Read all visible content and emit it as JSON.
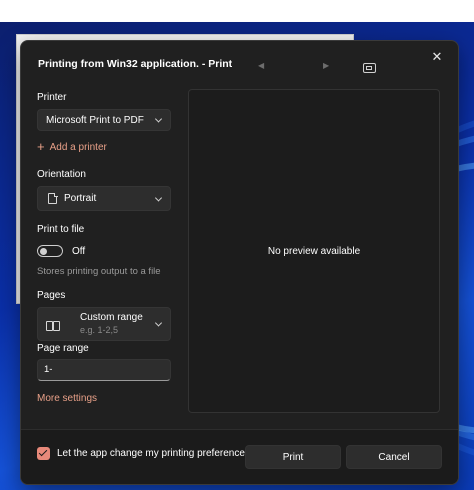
{
  "dialog": {
    "title": "Printing from Win32 application. - Print",
    "close_icon": "close-icon"
  },
  "printer": {
    "label": "Printer",
    "selected": "Microsoft Print to PDF",
    "add_label": "Add a printer"
  },
  "orientation": {
    "label": "Orientation",
    "selected": "Portrait"
  },
  "print_to_file": {
    "label": "Print to file",
    "state": "Off",
    "hint": "Stores printing output to a file"
  },
  "pages": {
    "label": "Pages",
    "selected": "Custom range",
    "example": "e.g. 1-2,5"
  },
  "page_range": {
    "label": "Page range",
    "value": "1-"
  },
  "more_settings": "More settings",
  "preview": {
    "message": "No preview available"
  },
  "footer": {
    "checkbox_label": "Let the app change my printing preferences",
    "checkbox_checked": true,
    "print_label": "Print",
    "cancel_label": "Cancel"
  },
  "colors": {
    "accent": "#e8897a",
    "dialog_bg": "#202020"
  }
}
